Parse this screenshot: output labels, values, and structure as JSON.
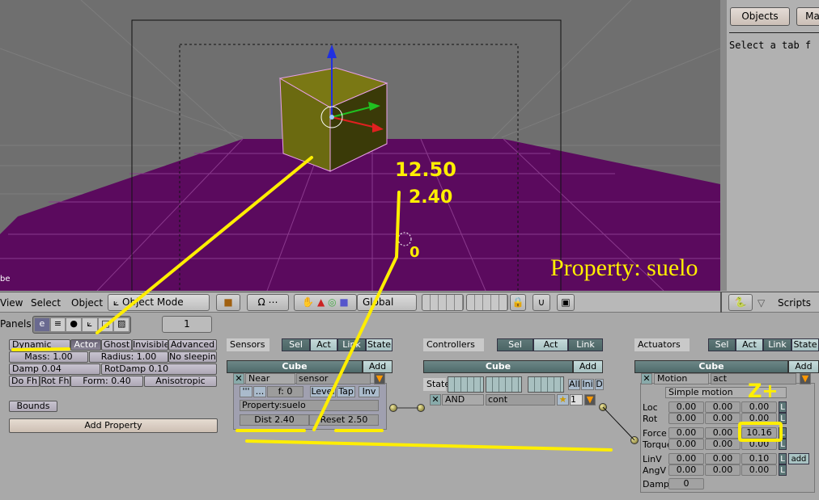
{
  "viewport": {
    "corner_label": "be",
    "overlay_text": "Property: suelo",
    "plane_color": "#5b0a5e",
    "cube_color": "#6b6a10"
  },
  "annotations": {
    "top": "12.50",
    "mid": "2.40",
    "bottom": "0",
    "zplus": "Z+",
    "color": "#ffee00"
  },
  "right_panel": {
    "tabs": [
      "Objects",
      "Ma"
    ],
    "message": "Select a tab f"
  },
  "header": {
    "menus": [
      "View",
      "Select",
      "Object"
    ],
    "mode": "Object Mode",
    "orientation": "Global",
    "scripts_label": "Scripts"
  },
  "panels": {
    "label": "Panels",
    "frame": "1"
  },
  "physics": {
    "type": "Dynamic",
    "toggles": [
      "Actor",
      "Ghost",
      "Invisible",
      "Advanced"
    ],
    "mass": "Mass: 1.00",
    "radius": "Radius: 1.00",
    "no_sleeping": "No sleeping",
    "damp": "Damp 0.04",
    "rotdamp": "RotDamp 0.10",
    "do_fh": "Do Fh",
    "rot_fh": "Rot Fh",
    "form": "Form: 0.40",
    "anisotropic": "Anisotropic",
    "bounds": "Bounds",
    "add_property": "Add Property"
  },
  "sensors": {
    "title": "Sensors",
    "filters": [
      "Sel",
      "Act",
      "Link",
      "State"
    ],
    "object": "Cube",
    "add": "Add",
    "type": "Near",
    "name": "sensor",
    "pulse_on": "'''",
    "pulse_off": "...",
    "freq": "f: 0",
    "level": "Level",
    "tap": "Tap",
    "inv": "Inv",
    "property": "Property:suelo",
    "dist": "Dist 2.40",
    "reset": "Reset 2.50"
  },
  "controllers": {
    "title": "Controllers",
    "filters": [
      "Sel",
      "Act",
      "Link"
    ],
    "object": "Cube",
    "add": "Add",
    "state_label": "State",
    "state_buttons": [
      "All",
      "Ini",
      "D"
    ],
    "type": "AND",
    "name": "cont",
    "priority": "1"
  },
  "actuators": {
    "title": "Actuators",
    "filters": [
      "Sel",
      "Act",
      "Link",
      "State"
    ],
    "object": "Cube",
    "add": "Add",
    "type": "Motion",
    "name": "act",
    "mode": "Simple motion",
    "rows": [
      {
        "label": "Loc",
        "values": [
          "0.00",
          "0.00",
          "0.00"
        ],
        "local": "L"
      },
      {
        "label": "Rot",
        "values": [
          "0.00",
          "0.00",
          "0.00"
        ],
        "local": "L"
      },
      {
        "label": "Force",
        "values": [
          "0.00",
          "0.00",
          "10.16"
        ],
        "local": "L"
      },
      {
        "label": "Torque",
        "values": [
          "0.00",
          "0.00",
          "0.00"
        ],
        "local": "L"
      },
      {
        "label": "LinV",
        "values": [
          "0.00",
          "0.00",
          "0.10"
        ],
        "local": "L",
        "extra": "add"
      },
      {
        "label": "AngV",
        "values": [
          "0.00",
          "0.00",
          "0.00"
        ],
        "local": "L"
      }
    ],
    "damp_label": "Damp",
    "damp_value": "0"
  }
}
